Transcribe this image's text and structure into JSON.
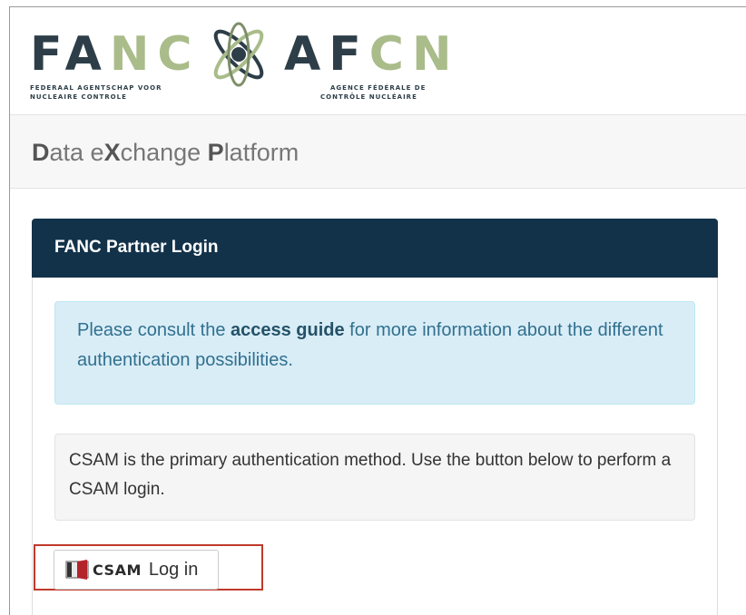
{
  "logo": {
    "left_word": "FANC",
    "right_word": "AFCN",
    "left_sub_line1": "FEDERAAL AGENTSCHAP VOOR",
    "left_sub_line2": "NUCLEAIRE CONTROLE",
    "right_sub_line1": "AGENCE FÉDÉRALE DE",
    "right_sub_line2": "CONTRÔLE NUCLÉAIRE"
  },
  "platform": {
    "title_parts": [
      "D",
      "ata e",
      "X",
      "change ",
      "P",
      "latform"
    ]
  },
  "panel": {
    "title": "FANC Partner Login",
    "info_before": "Please consult the ",
    "info_link": "access guide",
    "info_after": " for more information about the different authentication possibilities.",
    "method_text": "CSAM is the primary authentication method. Use the button below to perform a CSAM login."
  },
  "login_button": {
    "brand": "CSAM",
    "label": "Log in"
  },
  "colors": {
    "panel_heading": "#12324a",
    "info_bg": "#d9edf7",
    "logo_dark": "#2d3e48",
    "logo_green": "#a9bc8a",
    "highlight": "#c0392b"
  }
}
